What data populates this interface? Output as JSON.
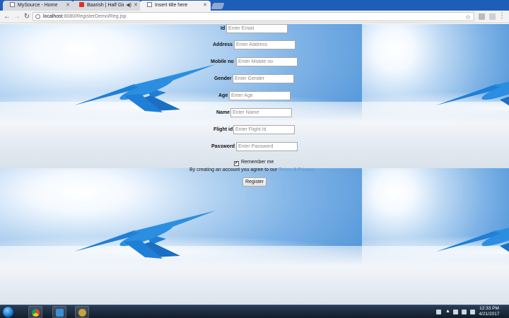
{
  "tabs": [
    {
      "title": "MySource - Home",
      "icon": "page-icon",
      "active": false
    },
    {
      "title": "Baarish | Half Girlfrien",
      "icon": "youtube-icon",
      "active": false
    },
    {
      "title": "Insert title here",
      "icon": "page-icon",
      "active": true
    }
  ],
  "address": {
    "host": "localhost",
    "path": ":8080/RegisterDemo/Reg.jsp"
  },
  "form": {
    "fields": [
      {
        "label": "Id",
        "placeholder": "Enter Email"
      },
      {
        "label": "Address",
        "placeholder": "Enter Address"
      },
      {
        "label": "Mobile no",
        "placeholder": "Enter Mobile no"
      },
      {
        "label": "Gender",
        "placeholder": "Enter Gender"
      },
      {
        "label": "Age",
        "placeholder": "Enter Age"
      },
      {
        "label": "Name",
        "placeholder": "Enter Name"
      },
      {
        "label": "Flight id",
        "placeholder": "Enter Flight Id"
      },
      {
        "label": "Password",
        "placeholder": "Enter Password"
      }
    ],
    "remember": {
      "label": "Remember me",
      "checked": true
    },
    "terms_text": "By creating an account you agree to our",
    "terms_link": "Terms & Privacy",
    "register_label": "Register"
  },
  "taskbar": {
    "clock_time": "12:33 PM",
    "clock_date": "4/21/2017"
  },
  "colors": {
    "tabstrip": "#1f5eb8",
    "sky": "#5b9cdc",
    "taskbar": "#1b2a3d"
  }
}
